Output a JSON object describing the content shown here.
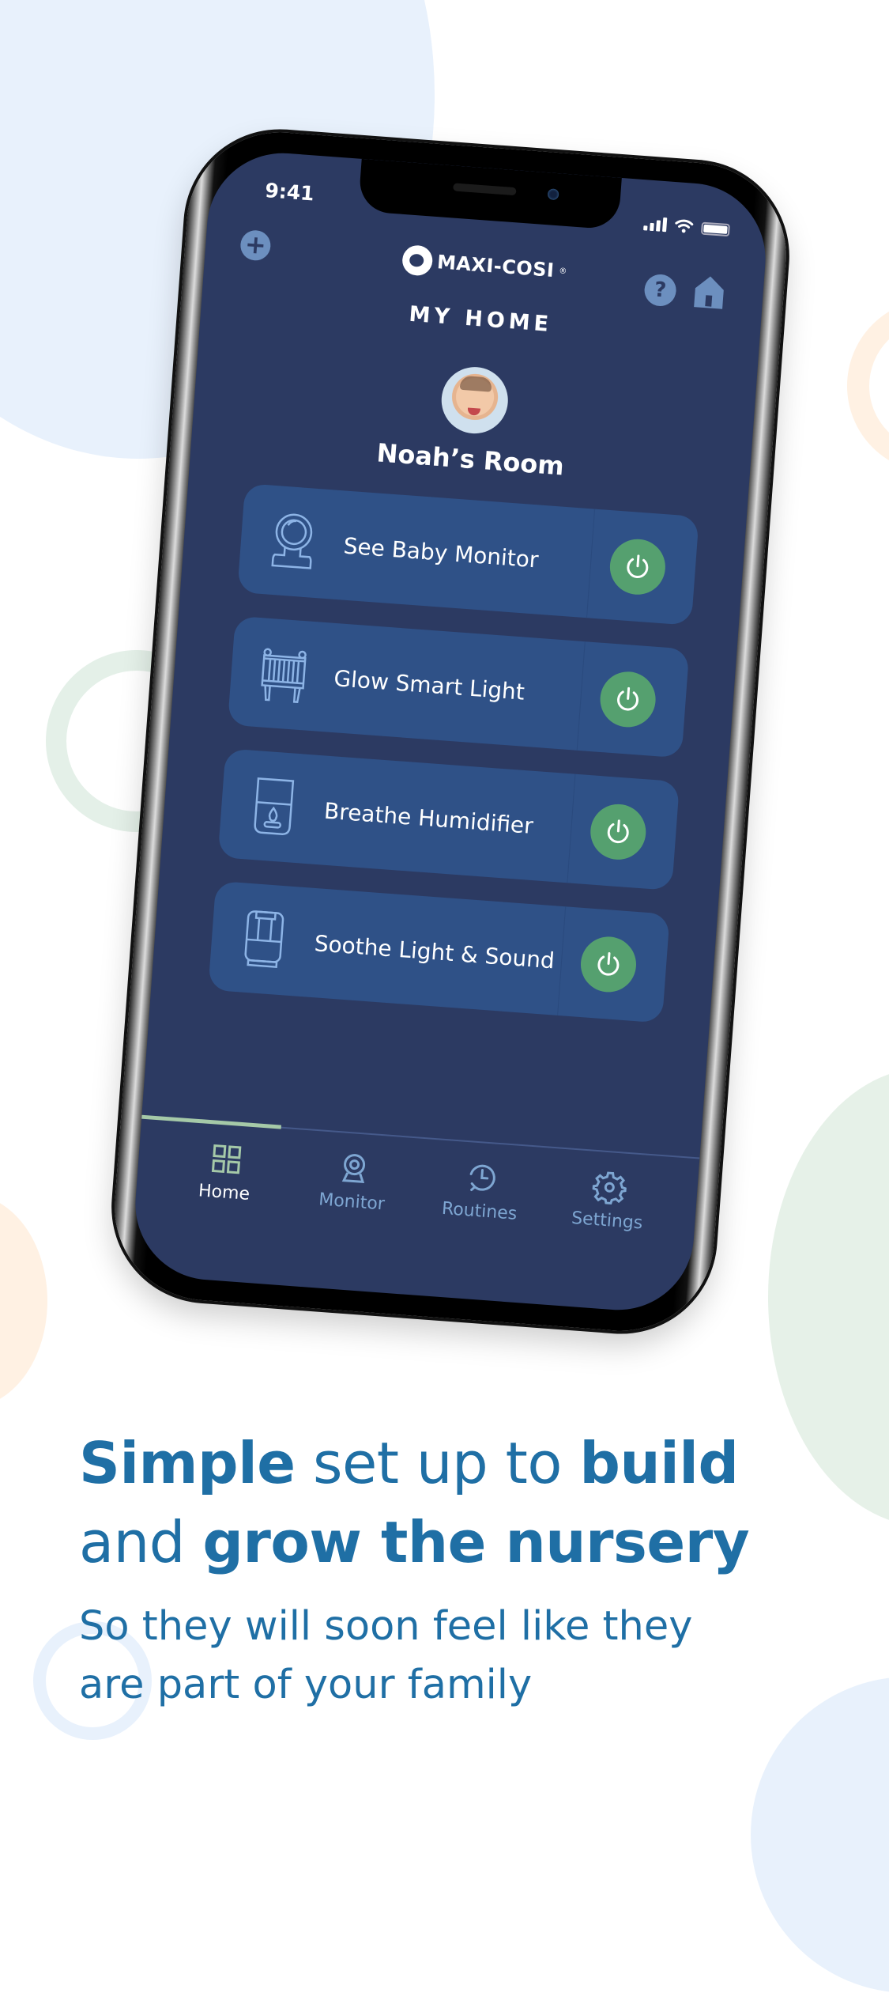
{
  "status_bar": {
    "time": "9:41"
  },
  "header": {
    "brand": "MAXI-COSI",
    "brand_mark": "®",
    "title": "MY HOME",
    "add_icon": "plus-icon",
    "help_icon": "question-icon",
    "home_icon": "house-icon"
  },
  "room": {
    "name": "Noah’s Room",
    "avatar": "baby-photo"
  },
  "devices": [
    {
      "label": "See Baby Monitor",
      "icon": "camera-monitor-icon",
      "power": "on"
    },
    {
      "label": "Glow Smart Light",
      "icon": "crib-icon",
      "power": "on"
    },
    {
      "label": "Breathe Humidifier",
      "icon": "humidifier-icon",
      "power": "on"
    },
    {
      "label": "Soothe Light & Sound",
      "icon": "speaker-icon",
      "power": "on"
    }
  ],
  "tabs": [
    {
      "label": "Home",
      "icon": "grid-icon",
      "active": true
    },
    {
      "label": "Monitor",
      "icon": "webcam-icon",
      "active": false
    },
    {
      "label": "Routines",
      "icon": "clock-history-icon",
      "active": false
    },
    {
      "label": "Settings",
      "icon": "gear-icon",
      "active": false
    }
  ],
  "promo": {
    "headline_1_bold": "Simple",
    "headline_1_regular": " set up to ",
    "headline_1_bold_2": "build",
    "headline_2_regular": "and ",
    "headline_2_bold": "grow the nursery",
    "subline_1": "So they will soon feel like they",
    "subline_2": "are part of your family"
  },
  "colors": {
    "screen_bg": "#2c3a62",
    "card_bg": "#2f5187",
    "power_on": "#55a06f",
    "accent_line": "#a5c9a8",
    "promo_text": "#1f6fa5"
  }
}
